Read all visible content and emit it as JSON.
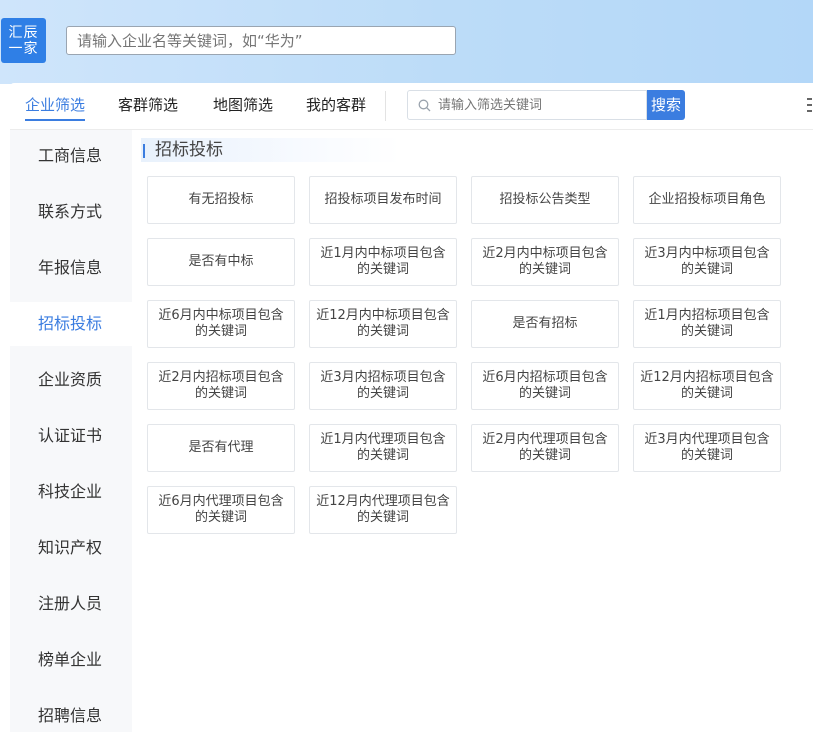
{
  "logo": {
    "line1": "汇辰",
    "line2": "一家"
  },
  "hero_search": {
    "placeholder": "请输入企业名等关键词，如“华为”"
  },
  "tabs": [
    {
      "label": "企业筛选",
      "active": true
    },
    {
      "label": "客群筛选",
      "active": false
    },
    {
      "label": "地图筛选",
      "active": false
    },
    {
      "label": "我的客群",
      "active": false
    }
  ],
  "filter": {
    "placeholder": "请输入筛选关键词",
    "button": "搜索"
  },
  "sidebar": [
    {
      "label": "工商信息",
      "active": false
    },
    {
      "label": "联系方式",
      "active": false
    },
    {
      "label": "年报信息",
      "active": false
    },
    {
      "label": "招标投标",
      "active": true
    },
    {
      "label": "企业资质",
      "active": false
    },
    {
      "label": "认证证书",
      "active": false
    },
    {
      "label": "科技企业",
      "active": false
    },
    {
      "label": "知识产权",
      "active": false
    },
    {
      "label": "注册人员",
      "active": false
    },
    {
      "label": "榜单企业",
      "active": false
    },
    {
      "label": "招聘信息",
      "active": false
    }
  ],
  "section": {
    "title": "招标投标"
  },
  "options": [
    "有无招投标",
    "招投标项目发布时间",
    "招投标公告类型",
    "企业招投标项目角色",
    "是否有中标",
    "近1月内中标项目包含的关键词",
    "近2月内中标项目包含的关键词",
    "近3月内中标项目包含的关键词",
    "近6月内中标项目包含的关键词",
    "近12月内中标项目包含的关键词",
    "是否有招标",
    "近1月内招标项目包含的关键词",
    "近2月内招标项目包含的关键词",
    "近3月内招标项目包含的关键词",
    "近6月内招标项目包含的关键词",
    "近12月内招标项目包含的关键词",
    "是否有代理",
    "近1月内代理项目包含的关键词",
    "近2月内代理项目包含的关键词",
    "近3月内代理项目包含的关键词",
    "近6月内代理项目包含的关键词",
    "近12月内代理项目包含的关键词"
  ],
  "colors": {
    "accent": "#3b7de0",
    "logo_bg": "#2f7fe6"
  }
}
